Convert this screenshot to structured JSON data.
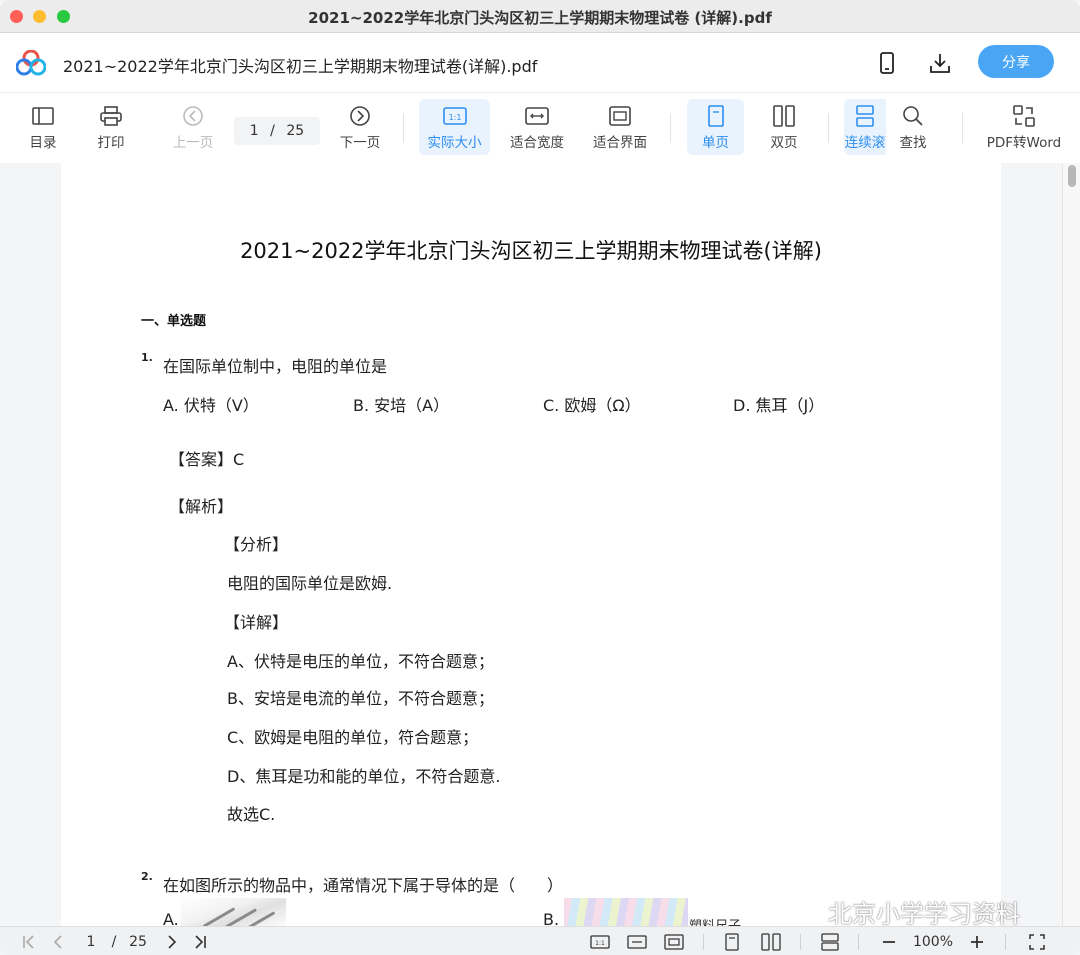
{
  "window": {
    "title": "2021~2022学年北京门头沟区初三上学期期末物理试卷 (详解).pdf"
  },
  "header": {
    "doc_title": "2021~2022学年北京门头沟区初三上学期期末物理试卷(详解).pdf",
    "share_label": "分享",
    "icons": [
      "app-logo-icon",
      "mobile-icon",
      "download-icon"
    ],
    "accent": "#4aa6f5"
  },
  "toolbar": {
    "toc": "目录",
    "print": "打印",
    "prev": "上一页",
    "page_current": "1",
    "page_sep": "/",
    "page_total": "25",
    "next": "下一页",
    "actual_size": "实际大小",
    "actual_size_icon_text": "1:1",
    "fit_width": "适合宽度",
    "fit_page": "适合界面",
    "single_page": "单页",
    "double_page": "双页",
    "continuous": "连续滚",
    "search": "查找",
    "pdf_to_word": "PDF转Word",
    "active_color": "#2e8ef0"
  },
  "document": {
    "title": "2021~2022学年北京门头沟区初三上学期期末物理试卷(详解)",
    "section": "一、单选题",
    "q1": {
      "num": "1.",
      "text": "在国际单位制中，电阻的单位是",
      "options": [
        "A. 伏特（V）",
        "B. 安培（A）",
        "C. 欧姆（Ω）",
        "D. 焦耳（J）"
      ],
      "answer": "【答案】C",
      "analysis_head": "【解析】",
      "analysis": "【分析】",
      "analysis_text": "电阻的国际单位是欧姆.",
      "detail": "【详解】",
      "lines": [
        "A、伏特是电压的单位，不符合题意；",
        "B、安培是电流的单位，不符合题意；",
        "C、欧姆是电阻的单位，符合题意；",
        "D、焦耳是功和能的单位，不符合题意."
      ],
      "conclusion": "故选C."
    },
    "q2": {
      "num": "2.",
      "text": "在如图所示的物品中，通常情况下属于导体的是（　　）",
      "opt_a": "A.",
      "opt_b": "B.",
      "opt_b_caption": "塑料尺子"
    }
  },
  "watermark": {
    "text": "北京小学学习资料"
  },
  "bottombar": {
    "page_current": "1",
    "page_sep": "/",
    "page_total": "25",
    "zoom": "100%"
  }
}
